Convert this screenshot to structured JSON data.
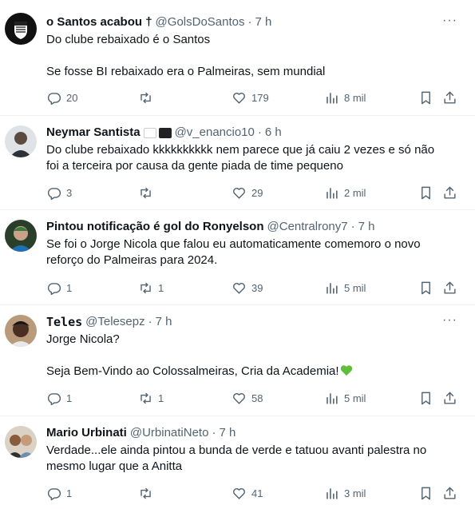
{
  "tweets": [
    {
      "name": "o Santos acabou †",
      "handle": "@GolsDoSantos",
      "time": "7 h",
      "lines": [
        "Do clube rebaixado é o Santos",
        "",
        "Se fosse BI rebaixado era o Palmeiras, sem mundial"
      ],
      "replies": "20",
      "retweets": "",
      "likes": "179",
      "views": "8 mil",
      "avatar": "santos-crest-icon"
    },
    {
      "name": "Neymar Santista",
      "handle": "@v_enancio10",
      "time": "6 h",
      "lines": [
        "Do clube rebaixado kkkkkkkkkk nem parece que já caiu 2 vezes e só não",
        "foi a terceira por causa da gente piada de time pequeno"
      ],
      "replies": "3",
      "retweets": "",
      "likes": "29",
      "views": "2 mil",
      "avatar": "person-photo"
    },
    {
      "name": "Pintou notificação é gol do Ronyelson",
      "handle": "@Centralrony7",
      "time": "7 h",
      "lines": [
        "Se foi o Jorge Nicola que falou eu automaticamente comemoro o novo",
        "reforço do Palmeiras para 2024."
      ],
      "replies": "1",
      "retweets": "1",
      "likes": "39",
      "views": "5 mil",
      "avatar": "person-photo"
    },
    {
      "name": "Teles",
      "handle": "@Telesepz",
      "time": "7 h",
      "lines": [
        "Jorge Nicola?",
        "",
        "Seja Bem-Vindo ao Colossalmeiras, Cria da Academia!"
      ],
      "replies": "1",
      "retweets": "1",
      "likes": "58",
      "views": "5 mil",
      "avatar": "person-photo"
    },
    {
      "name": "Mario Urbinati",
      "handle": "@UrbinatiNeto",
      "time": "7 h",
      "lines": [
        "Verdade...ele ainda pintou a bunda de verde e tatuou avanti palestra no",
        "mesmo lugar que a Anitta"
      ],
      "replies": "1",
      "retweets": "",
      "likes": "41",
      "views": "3 mil",
      "avatar": "person-photo"
    }
  ],
  "colors": {
    "text": "#0f1419",
    "secondary": "#536471",
    "divider": "#eff3f4",
    "green_heart": "#5fbf3a"
  }
}
